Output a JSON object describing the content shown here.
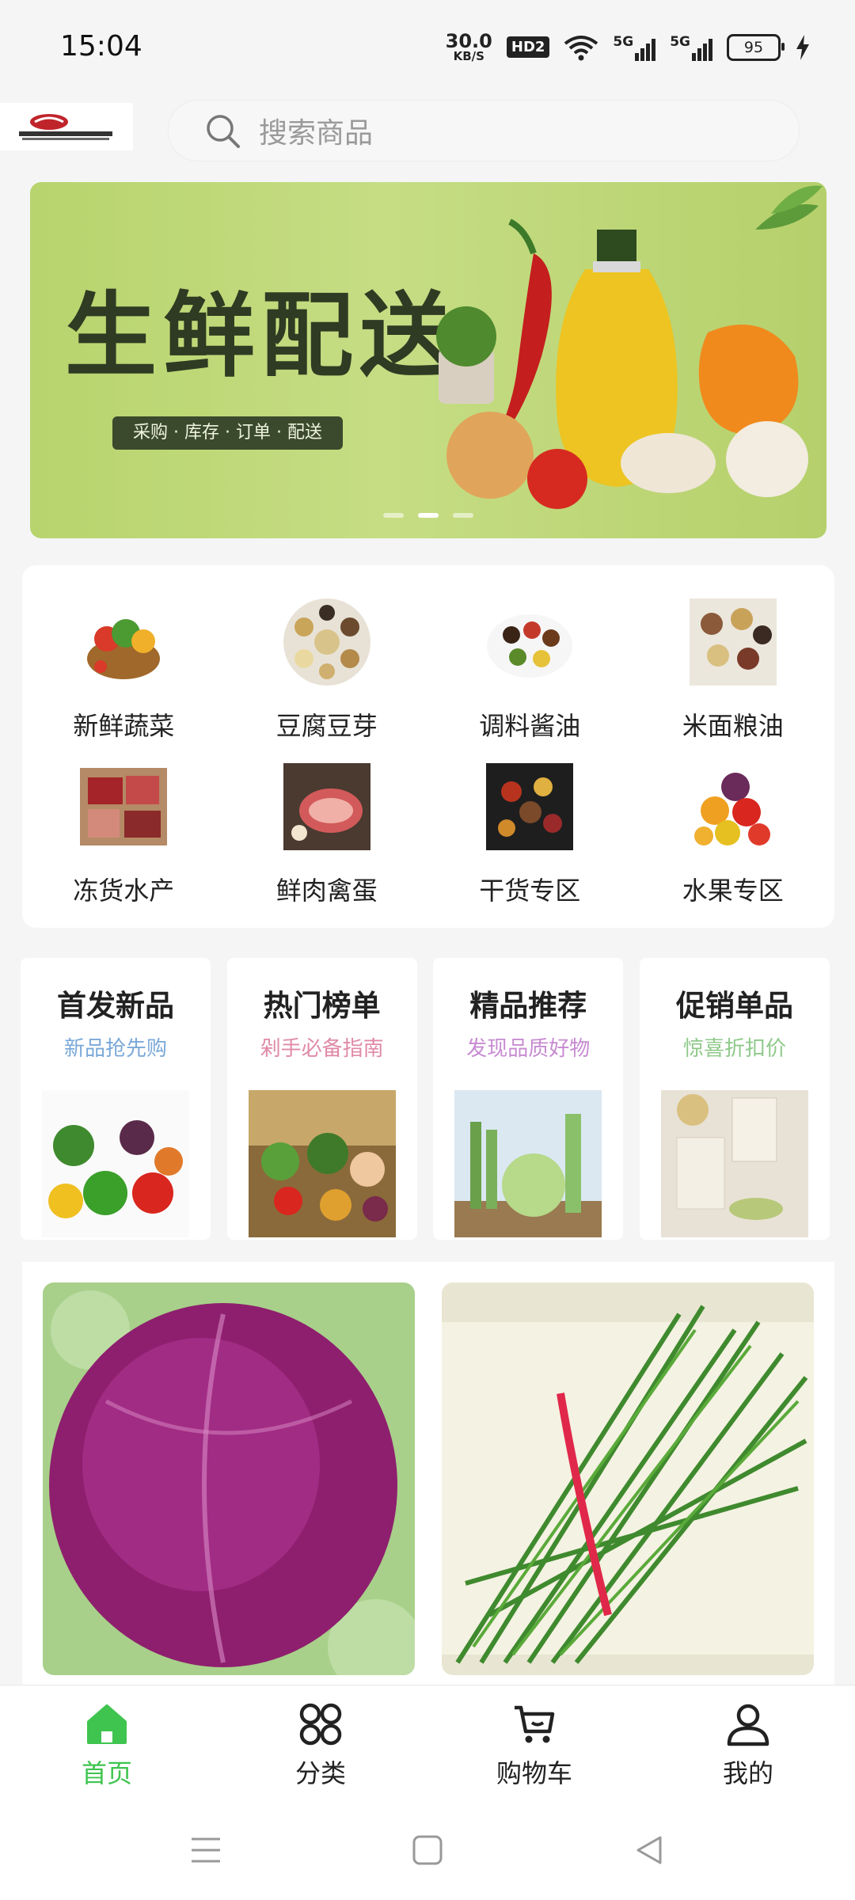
{
  "status": {
    "time": "15:04",
    "net_speed": "30.0",
    "net_unit": "KB/S",
    "hd": "HD2",
    "net1": "5G",
    "net2": "5G",
    "battery": "95"
  },
  "search": {
    "placeholder": "搜索商品"
  },
  "banner": {
    "title": "生鲜配送",
    "tagline": "采购 · 库存 · 订单 · 配送",
    "slides": 3,
    "active_slide": 2
  },
  "categories": [
    {
      "label": "新鲜蔬菜",
      "icon": "vegetable-basket-icon"
    },
    {
      "label": "豆腐豆芽",
      "icon": "beans-plate-icon"
    },
    {
      "label": "调料酱油",
      "icon": "sauce-bowls-icon"
    },
    {
      "label": "米面粮油",
      "icon": "grains-bowls-icon"
    },
    {
      "label": "冻货水产",
      "icon": "frozen-meat-icon"
    },
    {
      "label": "鲜肉禽蛋",
      "icon": "fresh-meat-icon"
    },
    {
      "label": "干货专区",
      "icon": "spices-icon"
    },
    {
      "label": "水果专区",
      "icon": "fruit-basket-icon"
    }
  ],
  "promos": [
    {
      "title": "首发新品",
      "subtitle": "新品抢先购",
      "color": "#7aa8d8"
    },
    {
      "title": "热门榜单",
      "subtitle": "剁手必备指南",
      "color": "#e08aa7"
    },
    {
      "title": "精品推荐",
      "subtitle": "发现品质好物",
      "color": "#c78bd1"
    },
    {
      "title": "促销单品",
      "subtitle": "惊喜折扣价",
      "color": "#8fc98a"
    }
  ],
  "products": [
    {
      "name": "purple-cabbage"
    },
    {
      "name": "chives-bundle"
    }
  ],
  "tabs": [
    {
      "label": "首页",
      "active": true
    },
    {
      "label": "分类",
      "active": false
    },
    {
      "label": "购物车",
      "active": false
    },
    {
      "label": "我的",
      "active": false
    }
  ],
  "colors": {
    "accent": "#3fc44f"
  }
}
